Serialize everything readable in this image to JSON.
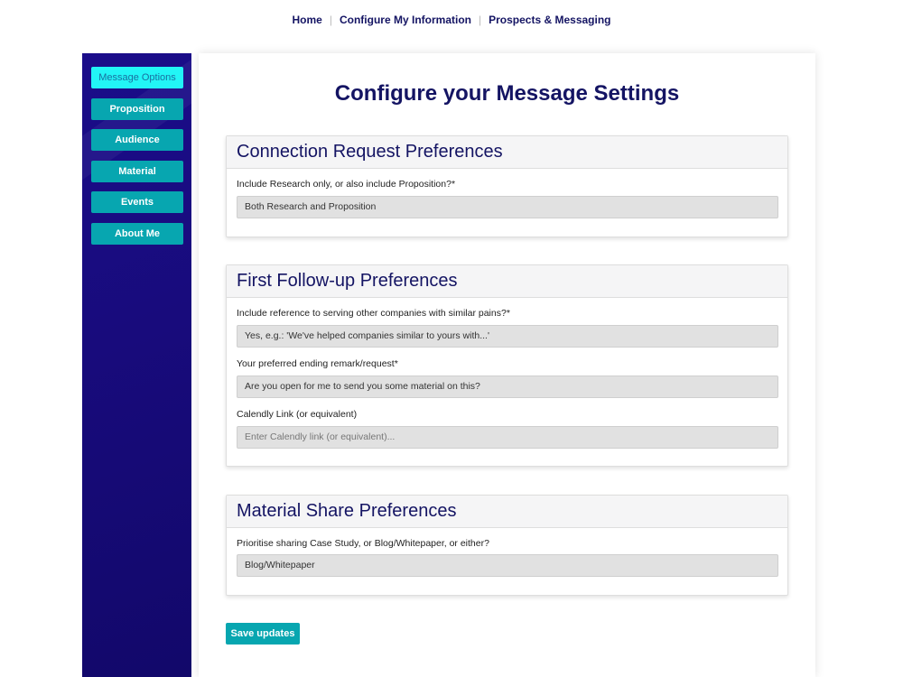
{
  "top_nav": {
    "home": "Home",
    "configure": "Configure My Information",
    "prospects": "Prospects & Messaging",
    "separator": "|"
  },
  "sidebar": {
    "items": [
      {
        "label": "Message Options",
        "active": true
      },
      {
        "label": "Proposition",
        "active": false
      },
      {
        "label": "Audience",
        "active": false
      },
      {
        "label": "Material",
        "active": false
      },
      {
        "label": "Events",
        "active": false
      },
      {
        "label": "About Me",
        "active": false
      }
    ]
  },
  "main": {
    "title": "Configure your Message Settings",
    "sections": [
      {
        "title": "Connection Request Preferences",
        "fields": [
          {
            "label": "Include Research only, or also include Proposition?*",
            "value": "Both Research and Proposition",
            "placeholder": ""
          }
        ]
      },
      {
        "title": "First Follow-up Preferences",
        "fields": [
          {
            "label": "Include reference to serving other companies with similar pains?*",
            "value": "Yes, e.g.: 'We've helped companies similar to yours with...'",
            "placeholder": ""
          },
          {
            "label": "Your preferred ending remark/request*",
            "value": "Are you open for me to send you some material on this?",
            "placeholder": ""
          },
          {
            "label": "Calendly Link (or equivalent)",
            "value": "",
            "placeholder": "Enter Calendly link (or equivalent)..."
          }
        ]
      },
      {
        "title": "Material Share Preferences",
        "fields": [
          {
            "label": "Prioritise sharing Case Study, or Blog/Whitepaper, or either?",
            "value": "Blog/Whitepaper",
            "placeholder": ""
          }
        ]
      }
    ],
    "save_label": "Save updates"
  },
  "colors": {
    "navy": "#141463",
    "teal": "#07a6b0",
    "cyan_active": "#22f5f6",
    "sidebar_bg": "#180b7c"
  }
}
